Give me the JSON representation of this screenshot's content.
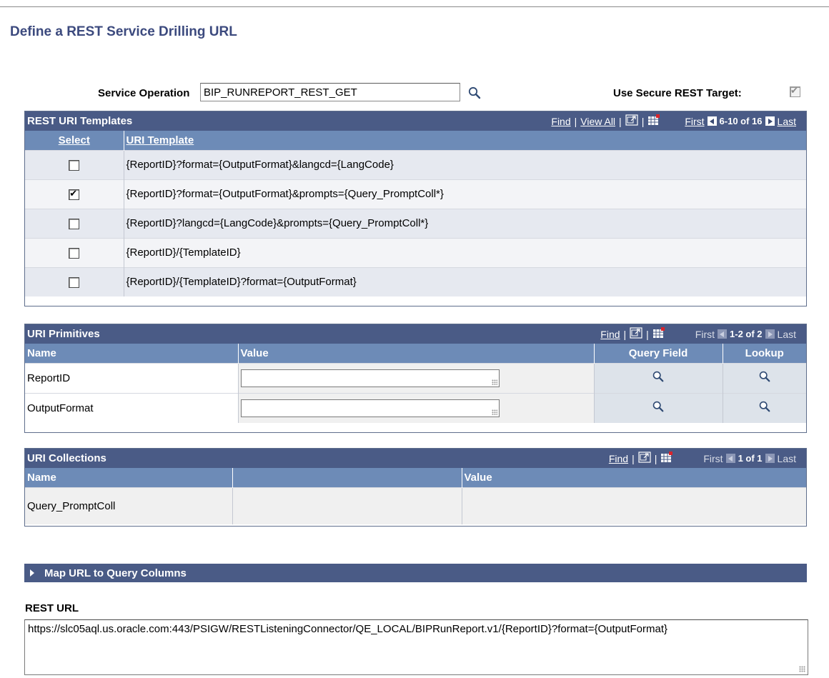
{
  "page_title": "Define a REST Service Drilling URL",
  "service_operation": {
    "label": "Service Operation",
    "value": "BIP_RUNREPORT_REST_GET"
  },
  "secure_target": {
    "label": "Use Secure REST Target:",
    "checked": true
  },
  "templates_grid": {
    "title": "REST URI Templates",
    "nav": {
      "find": "Find",
      "view_all": "View All",
      "first": "First",
      "count": "6-10 of 16",
      "last": "Last"
    },
    "columns": [
      "Select",
      "URI Template"
    ],
    "rows": [
      {
        "checked": false,
        "template": "{ReportID}?format={OutputFormat}&langcd={LangCode}"
      },
      {
        "checked": true,
        "template": "{ReportID}?format={OutputFormat}&prompts={Query_PromptColl*}"
      },
      {
        "checked": false,
        "template": "{ReportID}?langcd={LangCode}&prompts={Query_PromptColl*}"
      },
      {
        "checked": false,
        "template": "{ReportID}/{TemplateID}"
      },
      {
        "checked": false,
        "template": "{ReportID}/{TemplateID}?format={OutputFormat}"
      }
    ]
  },
  "primitives_grid": {
    "title": "URI Primitives",
    "nav": {
      "find": "Find",
      "first": "First",
      "count": "1-2 of 2",
      "last": "Last"
    },
    "columns": [
      "Name",
      "Value",
      "Query Field",
      "Lookup"
    ],
    "rows": [
      {
        "name": "ReportID",
        "value": ""
      },
      {
        "name": "OutputFormat",
        "value": ""
      }
    ]
  },
  "collections_grid": {
    "title": "URI Collections",
    "nav": {
      "find": "Find",
      "first": "First",
      "count": "1 of 1",
      "last": "Last"
    },
    "columns": [
      "Name",
      "",
      "Value"
    ],
    "rows": [
      {
        "name": "Query_PromptColl",
        "value": ""
      }
    ]
  },
  "map_section": {
    "label": "Map URL to Query Columns"
  },
  "rest_url": {
    "label": "REST URL",
    "value": "https://slc05aql.us.oracle.com:443/PSIGW/RESTListeningConnector/QE_LOCAL/BIPRunReport.v1/{ReportID}?format={OutputFormat}"
  },
  "icons": {
    "lookup": "magnifier-icon",
    "zoom": "zoom-grid-icon",
    "download": "download-excel-icon",
    "prev": "prev-arrow-icon",
    "next": "next-arrow-icon",
    "expand": "expand-triangle-icon"
  }
}
